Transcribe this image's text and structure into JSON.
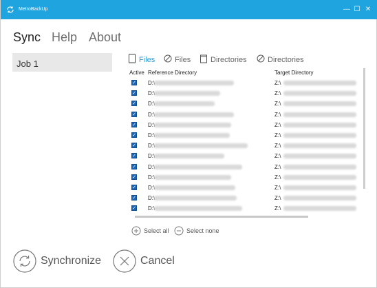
{
  "window": {
    "title": "MetroBackUp",
    "controls": {
      "minimize": "—",
      "maximize": "☐",
      "close": "✕"
    },
    "accent_color": "#1fa4e0"
  },
  "menu": {
    "sync": "Sync",
    "help": "Help",
    "about": "About"
  },
  "jobs": [
    "Job 1"
  ],
  "filters": [
    {
      "label": "Files",
      "state": "include",
      "icon": "file-icon",
      "active": true
    },
    {
      "label": "Files",
      "state": "exclude",
      "icon": "block-icon",
      "active": false
    },
    {
      "label": "Directories",
      "state": "include",
      "icon": "folder-icon",
      "active": false
    },
    {
      "label": "Directories",
      "state": "exclude",
      "icon": "block-icon",
      "active": false
    }
  ],
  "table": {
    "headers": {
      "active": "Active",
      "reference": "Reference Directory",
      "target": "Target Directory"
    },
    "rows": [
      {
        "checked": true,
        "reference_prefix": "D:\\",
        "target_prefix": "Z:\\"
      },
      {
        "checked": true,
        "reference_prefix": "D:\\",
        "target_prefix": "Z:\\"
      },
      {
        "checked": true,
        "reference_prefix": "D:\\",
        "target_prefix": "Z:\\"
      },
      {
        "checked": true,
        "reference_prefix": "D:\\",
        "target_prefix": "Z:\\"
      },
      {
        "checked": true,
        "reference_prefix": "D:\\",
        "target_prefix": "Z:\\"
      },
      {
        "checked": true,
        "reference_prefix": "D:\\",
        "target_prefix": "Z:\\"
      },
      {
        "checked": true,
        "reference_prefix": "D:\\",
        "target_prefix": "Z:\\"
      },
      {
        "checked": true,
        "reference_prefix": "D:\\",
        "target_prefix": "Z:\\"
      },
      {
        "checked": true,
        "reference_prefix": "D:\\",
        "target_prefix": "Z:\\"
      },
      {
        "checked": true,
        "reference_prefix": "D:\\",
        "target_prefix": "Z:\\"
      },
      {
        "checked": true,
        "reference_prefix": "D:\\",
        "target_prefix": "Z:\\"
      },
      {
        "checked": true,
        "reference_prefix": "D:\\",
        "target_prefix": "Z:\\"
      },
      {
        "checked": true,
        "reference_prefix": "D:\\",
        "target_prefix": "Z:\\"
      }
    ]
  },
  "selection": {
    "select_all": "Select all",
    "select_none": "Select none"
  },
  "actions": {
    "synchronize": "Synchronize",
    "cancel": "Cancel"
  },
  "check_glyph": "✓"
}
